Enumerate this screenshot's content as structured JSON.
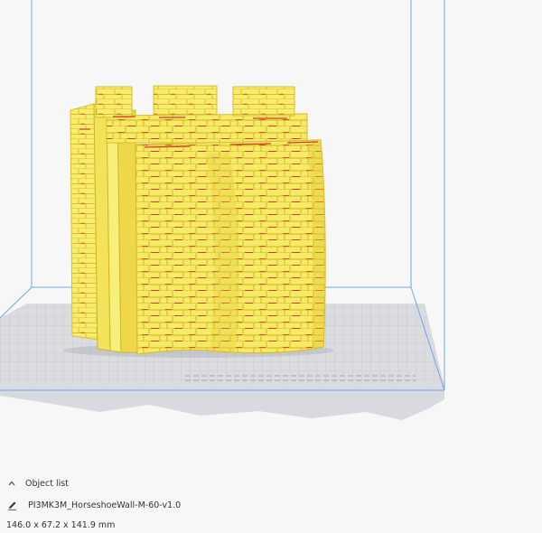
{
  "object_list": {
    "label": "Object list",
    "icon": "chevron-up-icon"
  },
  "model": {
    "name": "PI3MK3M_HorseshoeWall-M-60-v1.0",
    "dimensions": "146.0 x 67.2 x 141.9 mm",
    "edit_icon": "pencil-icon"
  },
  "colors": {
    "background": "#f7f7f8",
    "build_volume": "#6fa8e6",
    "build_plate": "#c9cbd0",
    "model": "#f6ea66",
    "model_shadow": "#e2c938",
    "overhang": "#d63a2f"
  }
}
